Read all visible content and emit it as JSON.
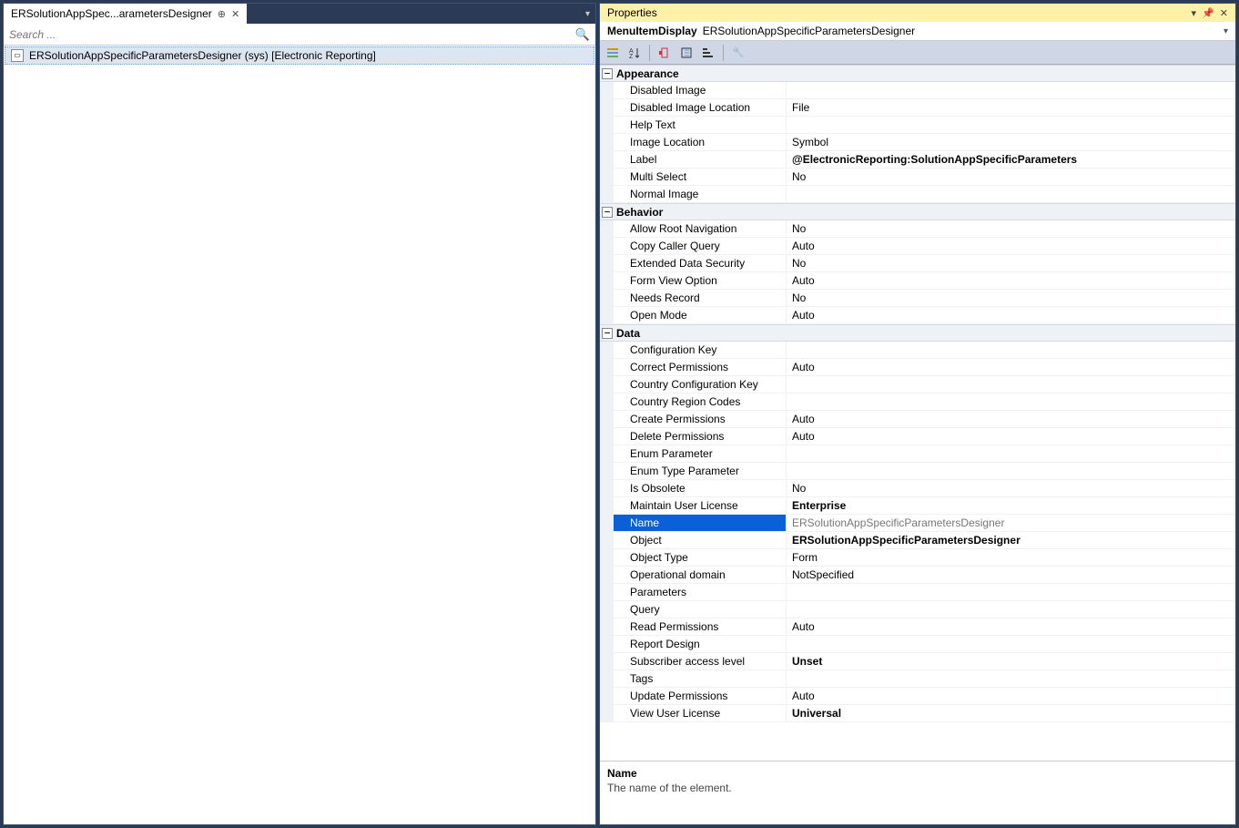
{
  "left": {
    "tab_label": "ERSolutionAppSpec...arametersDesigner",
    "search_placeholder": "Search ...",
    "tree_item": "ERSolutionAppSpecificParametersDesigner (sys) [Electronic Reporting]"
  },
  "props": {
    "title": "Properties",
    "object_type": "MenuItemDisplay",
    "object_name": "ERSolutionAppSpecificParametersDesigner",
    "categories": [
      {
        "name": "Appearance",
        "rows": [
          {
            "label": "Disabled Image",
            "value": ""
          },
          {
            "label": "Disabled Image Location",
            "value": "File"
          },
          {
            "label": "Help Text",
            "value": ""
          },
          {
            "label": "Image Location",
            "value": "Symbol"
          },
          {
            "label": "Label",
            "value": "@ElectronicReporting:SolutionAppSpecificParameters",
            "bold": true
          },
          {
            "label": "Multi Select",
            "value": "No"
          },
          {
            "label": "Normal Image",
            "value": ""
          }
        ]
      },
      {
        "name": "Behavior",
        "rows": [
          {
            "label": "Allow Root Navigation",
            "value": "No"
          },
          {
            "label": "Copy Caller Query",
            "value": "Auto"
          },
          {
            "label": "Extended Data Security",
            "value": "No"
          },
          {
            "label": "Form View Option",
            "value": "Auto"
          },
          {
            "label": "Needs Record",
            "value": "No"
          },
          {
            "label": "Open Mode",
            "value": "Auto"
          }
        ]
      },
      {
        "name": "Data",
        "rows": [
          {
            "label": "Configuration Key",
            "value": ""
          },
          {
            "label": "Correct Permissions",
            "value": "Auto"
          },
          {
            "label": "Country Configuration Key",
            "value": ""
          },
          {
            "label": "Country Region Codes",
            "value": ""
          },
          {
            "label": "Create Permissions",
            "value": "Auto"
          },
          {
            "label": "Delete Permissions",
            "value": "Auto"
          },
          {
            "label": "Enum Parameter",
            "value": ""
          },
          {
            "label": "Enum Type Parameter",
            "value": ""
          },
          {
            "label": "Is Obsolete",
            "value": "No"
          },
          {
            "label": "Maintain User License",
            "value": "Enterprise",
            "bold": true
          },
          {
            "label": "Name",
            "value": "ERSolutionAppSpecificParametersDesigner",
            "selected": true
          },
          {
            "label": "Object",
            "value": "ERSolutionAppSpecificParametersDesigner",
            "bold": true
          },
          {
            "label": "Object Type",
            "value": "Form"
          },
          {
            "label": "Operational domain",
            "value": "NotSpecified"
          },
          {
            "label": "Parameters",
            "value": ""
          },
          {
            "label": "Query",
            "value": ""
          },
          {
            "label": "Read Permissions",
            "value": "Auto"
          },
          {
            "label": "Report Design",
            "value": ""
          },
          {
            "label": "Subscriber access level",
            "value": "Unset",
            "bold": true
          },
          {
            "label": "Tags",
            "value": ""
          },
          {
            "label": "Update Permissions",
            "value": "Auto"
          },
          {
            "label": "View User License",
            "value": "Universal",
            "bold": true
          }
        ]
      }
    ],
    "desc_name": "Name",
    "desc_text": "The name of the element."
  }
}
